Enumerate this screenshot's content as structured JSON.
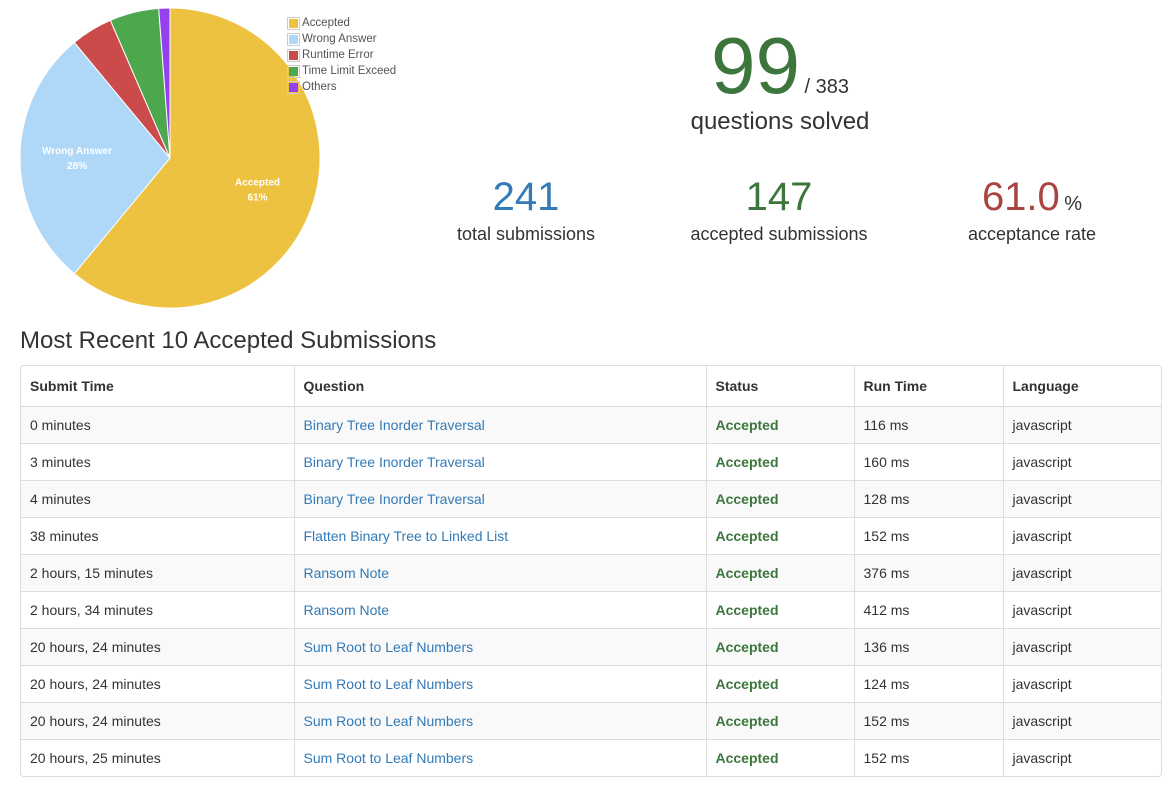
{
  "chart_data": {
    "type": "pie",
    "slices": [
      {
        "label": "Accepted",
        "value": 61,
        "color": "#EDC240",
        "data_label": "61%"
      },
      {
        "label": "Wrong Answer",
        "value": 28,
        "color": "#AFD8F8",
        "data_label": "28%"
      },
      {
        "label": "Runtime Error",
        "value": 4.5,
        "color": "#CB4B4B",
        "data_label": ""
      },
      {
        "label": "Time Limit Exceed",
        "value": 5.3,
        "color": "#4DA74D",
        "data_label": ""
      },
      {
        "label": "Others",
        "value": 1.2,
        "color": "#9440ED",
        "data_label": ""
      }
    ],
    "legend_position": "top-right"
  },
  "legend": [
    {
      "label": "Accepted",
      "color": "#EDC240"
    },
    {
      "label": "Wrong Answer",
      "color": "#AFD8F8"
    },
    {
      "label": "Runtime Error",
      "color": "#CB4B4B"
    },
    {
      "label": "Time Limit Exceed",
      "color": "#4DA74D"
    },
    {
      "label": "Others",
      "color": "#9440ED"
    }
  ],
  "stats": {
    "solved": "99",
    "solved_total": "/ 383",
    "solved_label": "questions solved",
    "total_submissions": "241",
    "total_submissions_label": "total submissions",
    "accepted_submissions": "147",
    "accepted_submissions_label": "accepted submissions",
    "acceptance_rate": "61.0",
    "acceptance_rate_unit": "%",
    "acceptance_rate_label": "acceptance rate"
  },
  "table": {
    "title": "Most Recent 10 Accepted Submissions",
    "headers": [
      "Submit Time",
      "Question",
      "Status",
      "Run Time",
      "Language"
    ],
    "rows": [
      {
        "time": "0 minutes",
        "question": "Binary Tree Inorder Traversal",
        "status": "Accepted",
        "runtime": "116 ms",
        "language": "javascript"
      },
      {
        "time": "3 minutes",
        "question": "Binary Tree Inorder Traversal",
        "status": "Accepted",
        "runtime": "160 ms",
        "language": "javascript"
      },
      {
        "time": "4 minutes",
        "question": "Binary Tree Inorder Traversal",
        "status": "Accepted",
        "runtime": "128 ms",
        "language": "javascript"
      },
      {
        "time": "38 minutes",
        "question": "Flatten Binary Tree to Linked List",
        "status": "Accepted",
        "runtime": "152 ms",
        "language": "javascript"
      },
      {
        "time": "2 hours, 15 minutes",
        "question": "Ransom Note",
        "status": "Accepted",
        "runtime": "376 ms",
        "language": "javascript"
      },
      {
        "time": "2 hours, 34 minutes",
        "question": "Ransom Note",
        "status": "Accepted",
        "runtime": "412 ms",
        "language": "javascript"
      },
      {
        "time": "20 hours, 24 minutes",
        "question": "Sum Root to Leaf Numbers",
        "status": "Accepted",
        "runtime": "136 ms",
        "language": "javascript"
      },
      {
        "time": "20 hours, 24 minutes",
        "question": "Sum Root to Leaf Numbers",
        "status": "Accepted",
        "runtime": "124 ms",
        "language": "javascript"
      },
      {
        "time": "20 hours, 24 minutes",
        "question": "Sum Root to Leaf Numbers",
        "status": "Accepted",
        "runtime": "152 ms",
        "language": "javascript"
      },
      {
        "time": "20 hours, 25 minutes",
        "question": "Sum Root to Leaf Numbers",
        "status": "Accepted",
        "runtime": "152 ms",
        "language": "javascript"
      }
    ]
  }
}
